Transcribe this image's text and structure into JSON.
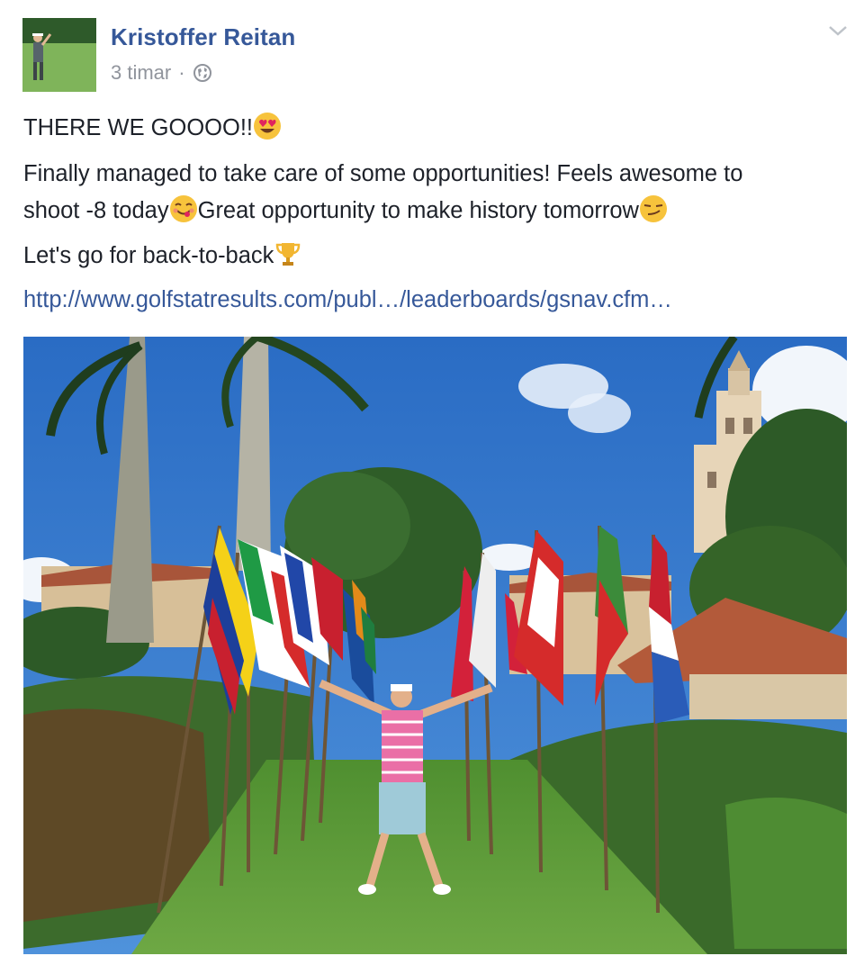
{
  "post": {
    "author_name": "Kristoffer Reitan",
    "timestamp": "3 timar",
    "separator": "·",
    "privacy_icon": "globe-icon",
    "menu_icon": "chevron-down-icon",
    "lines": {
      "line1": "THERE WE GOOOO!!",
      "line2": "Finally managed to take care of some opportunities! Feels awesome to",
      "line3a": "shoot -8 today",
      "line3b": "Great opportunity to make history tomorrow",
      "line4": "Let's go for back-to-back"
    },
    "emojis": {
      "heart_eyes": "heart-eyes-emoji",
      "yum": "yum-face-emoji",
      "smirk": "smirk-face-emoji",
      "trophy": "trophy-emoji"
    },
    "link_text": "http://www.golfstatresults.com/publ…/leaderboards/gsnav.cfm…",
    "photo_icon": "golfer-with-flags-photo"
  },
  "colors": {
    "author": "#365899",
    "meta": "#90949c",
    "text": "#1d2129",
    "link": "#365899",
    "sky": "#2f74c8",
    "grass": "#5f9f3a"
  }
}
